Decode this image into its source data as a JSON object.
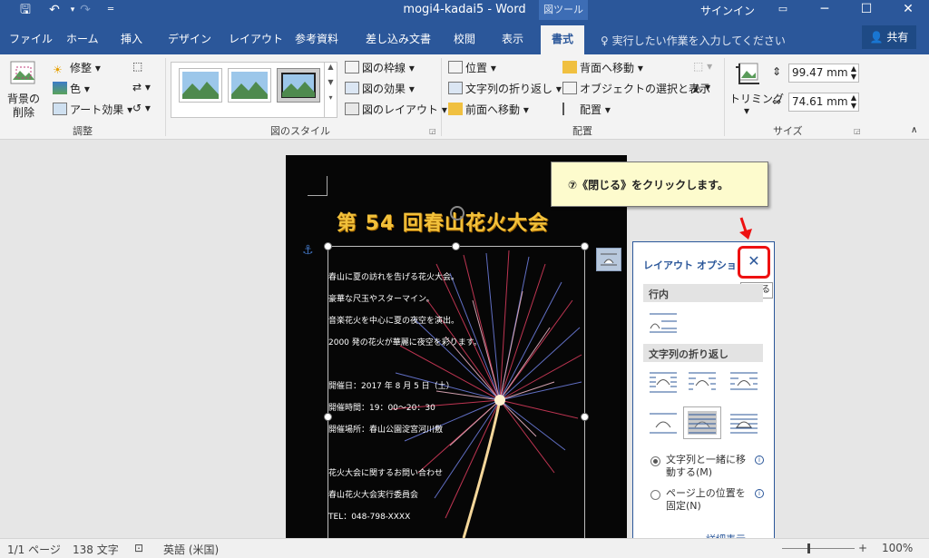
{
  "titlebar": {
    "title": "mogi4-kadai5  -  Word",
    "context_tool": "図ツール",
    "signin": "サインイン",
    "save_icon": "save-icon",
    "undo_icon": "undo-icon"
  },
  "tabs": [
    "ファイル",
    "ホーム",
    "挿入",
    "デザイン",
    "レイアウト",
    "参考資料",
    "差し込み文書",
    "校閲",
    "表示",
    "書式"
  ],
  "active_tab": "書式",
  "tellme": "実行したい作業を入力してください",
  "share": "共有",
  "ribbon": {
    "adjust": {
      "remove_bg_line1": "背景の",
      "remove_bg_line2": "削除",
      "corrections": "修整",
      "color": "色",
      "artistic": "アート効果",
      "label": "調整"
    },
    "styles": {
      "border": "図の枠線",
      "effects": "図の効果",
      "layout": "図のレイアウト",
      "label": "図のスタイル"
    },
    "arrange": {
      "position": "位置",
      "wrap": "文字列の折り返し",
      "forward": "前面へ移動",
      "backward": "背面へ移動",
      "selection": "オブジェクトの選択と表示",
      "align": "配置",
      "label": "配置"
    },
    "size": {
      "crop": "トリミング",
      "height": "99.47 mm",
      "width": "74.61 mm",
      "label": "サイズ"
    }
  },
  "document": {
    "title": "第 54 回春山花火大会",
    "lines": [
      "春山に夏の訪れを告げる花火大会。",
      "豪華な尺玉やスターマイン。",
      "音楽花火を中心に夏の夜空を演出。",
      "2000 発の花火が華麗に夜空を彩ります。",
      "開催日：2017 年 8 月 5 日（土）",
      "開催時間：19：00～20：30",
      "開催場所：春山公園淀宮河川敷",
      "花火大会に関するお問い合わせ",
      "春山花火大会実行委員会",
      "TEL：048-798-XXXX"
    ]
  },
  "callout": "⑦《閉じる》をクリックします。",
  "layout_options": {
    "title": "レイアウト オプション",
    "close_symbol": "✕",
    "close_tooltip": "閉じる",
    "inline_heading": "行内",
    "wrap_heading": "文字列の折り返し",
    "move_with_text": "文字列と一緒に移動する(M)",
    "fix_position": "ページ上の位置を固定(N)",
    "details": "詳細表示..."
  },
  "statusbar": {
    "page": "1/1 ページ",
    "words": "138 文字",
    "language": "英語 (米国)",
    "zoom": "100%"
  },
  "colors": {
    "accent": "#2b579a",
    "highlight_red": "#e11111",
    "callout_bg": "#fdfbcd",
    "title_gold": "#f2c13b"
  }
}
